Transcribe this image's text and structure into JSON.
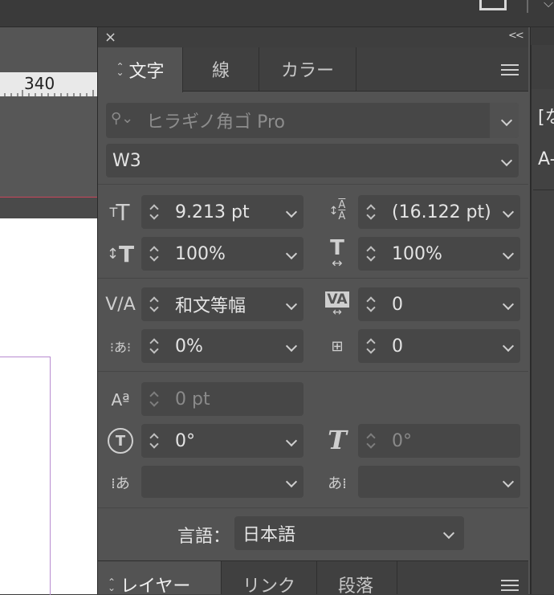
{
  "ruler": {
    "label": "340"
  },
  "right_panel": {
    "text1": "[な",
    "text2": "A-"
  },
  "panel": {
    "close_icon": "×",
    "collapse_icon": "<<",
    "tabs": [
      {
        "label": "文字",
        "active": true
      },
      {
        "label": "線",
        "active": false
      },
      {
        "label": "カラー",
        "active": false
      }
    ],
    "font_family": {
      "placeholder": "ヒラギノ角ゴ Pro"
    },
    "font_style": "W3",
    "font_size": "9.213 pt",
    "leading": "(16.122 pt)",
    "vertical_scale": "100%",
    "horizontal_scale": "100%",
    "kerning": "和文等幅",
    "tracking": "0",
    "tsume": "0%",
    "aki": "0",
    "baseline_shift": "0 pt",
    "rotation": "0°",
    "skew": "0°",
    "aki_before": "",
    "aki_after": "",
    "language": {
      "label": "言語：",
      "value": "日本語"
    }
  },
  "bottom_tabs": [
    {
      "label": "レイヤー",
      "active": true
    },
    {
      "label": "リンク",
      "active": false
    },
    {
      "label": "段落",
      "active": false
    }
  ]
}
